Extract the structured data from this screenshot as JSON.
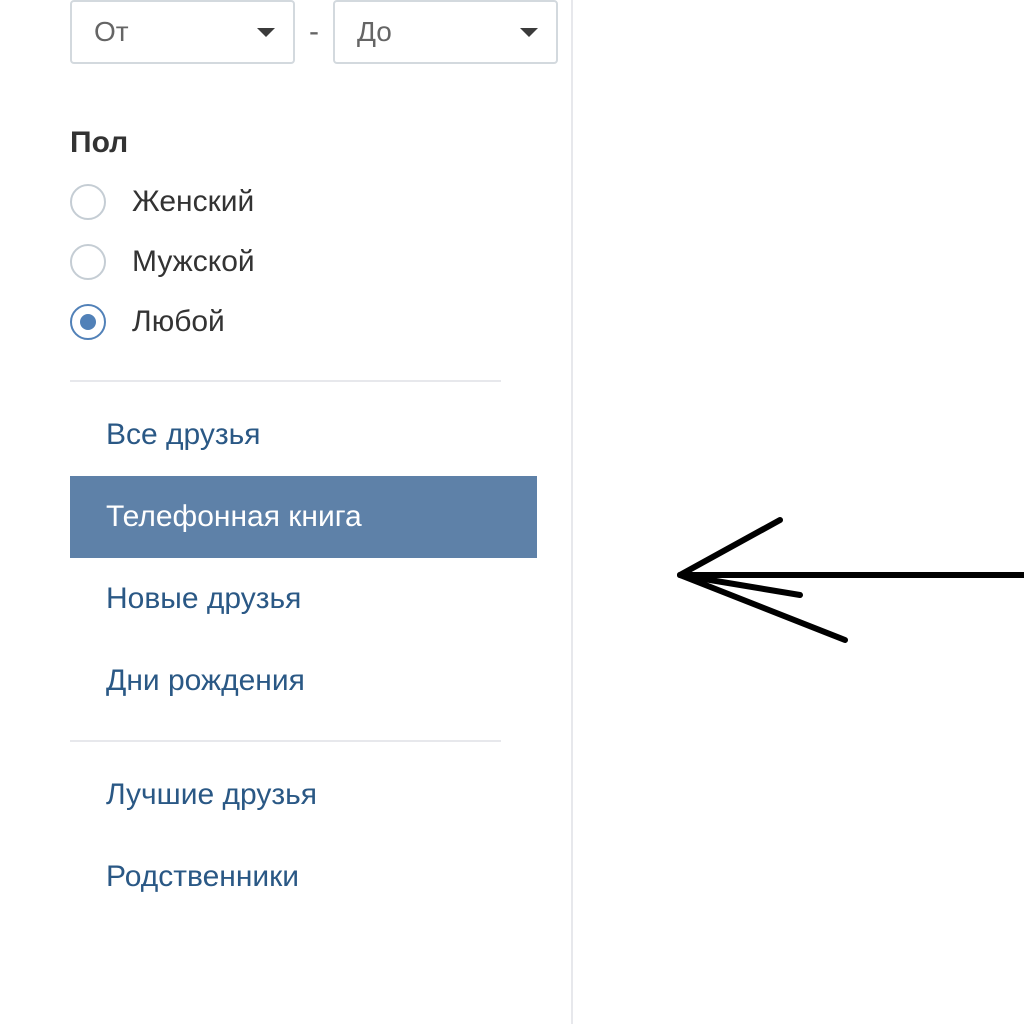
{
  "range": {
    "from_label": "От",
    "to_label": "До",
    "separator": "-"
  },
  "gender": {
    "title": "Пол",
    "options": [
      {
        "label": "Женский",
        "selected": false
      },
      {
        "label": "Мужской",
        "selected": false
      },
      {
        "label": "Любой",
        "selected": true
      }
    ]
  },
  "nav": {
    "items": [
      {
        "label": "Все друзья",
        "active": false
      },
      {
        "label": "Телефонная книга",
        "active": true
      },
      {
        "label": "Новые друзья",
        "active": false
      },
      {
        "label": "Дни рождения",
        "active": false
      }
    ],
    "groups": [
      {
        "label": "Лучшие друзья"
      },
      {
        "label": "Родственники"
      }
    ]
  },
  "colors": {
    "accent": "#5e81a8",
    "link": "#2a5885",
    "border": "#e7e8ec"
  }
}
